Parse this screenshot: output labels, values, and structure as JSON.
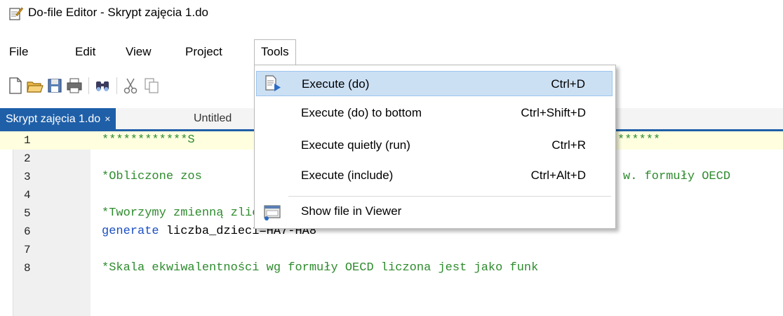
{
  "window": {
    "title": "Do-file Editor - Skrypt zajęcia 1.do",
    "icon": "do-file-editor-icon"
  },
  "menubar": {
    "items": [
      "File",
      "Edit",
      "View",
      "Project",
      "Tools"
    ],
    "open_menu": "Tools"
  },
  "toolbar": {
    "icons": [
      "new-file-icon",
      "open-folder-icon",
      "save-icon",
      "print-icon",
      "find-icon",
      "cut-icon",
      "copy-icon"
    ]
  },
  "tabs": [
    {
      "label": "Skrypt zajęcia 1.do",
      "close": "×",
      "active": true
    },
    {
      "label": "Untitled",
      "active": false
    }
  ],
  "editor": {
    "lines": [
      {
        "num": "1",
        "visible_text": "************S",
        "visible_text_right": "******",
        "highlighted": true
      },
      {
        "num": "2",
        "visible_text": ""
      },
      {
        "num": "3",
        "visible_text": "*Obliczone zos",
        "visible_text_right": "w. formuły OECD"
      },
      {
        "num": "4",
        "visible_text": ""
      },
      {
        "num": "5",
        "visible_text": "*Tworzymy zmienną zliczającą liczbę dzieci"
      },
      {
        "num": "6",
        "keyword": "generate",
        "visible_text": " liczba_dzieci=HA7-HA8"
      },
      {
        "num": "7",
        "visible_text": ""
      },
      {
        "num": "8",
        "visible_text": "*Skala ekwiwalentności wg formuły OECD liczona jest jako funk"
      }
    ]
  },
  "tools_menu": {
    "items": [
      {
        "label": "Execute (do)",
        "shortcut": "Ctrl+D",
        "icon": "execute-do-icon",
        "hovered": true
      },
      {
        "label": "Execute (do) to bottom",
        "shortcut": "Ctrl+Shift+D"
      },
      {
        "label": "Execute quietly (run)",
        "shortcut": "Ctrl+R"
      },
      {
        "label": "Execute (include)",
        "shortcut": "Ctrl+Alt+D"
      },
      {
        "label": "Show file in Viewer",
        "shortcut": "",
        "icon": "viewer-icon"
      }
    ]
  },
  "colors": {
    "tab_active": "#1f5fa8",
    "menu_hover": "#cce0f4",
    "comment": "#2e8b2e",
    "keyword": "#1a4fc2"
  }
}
